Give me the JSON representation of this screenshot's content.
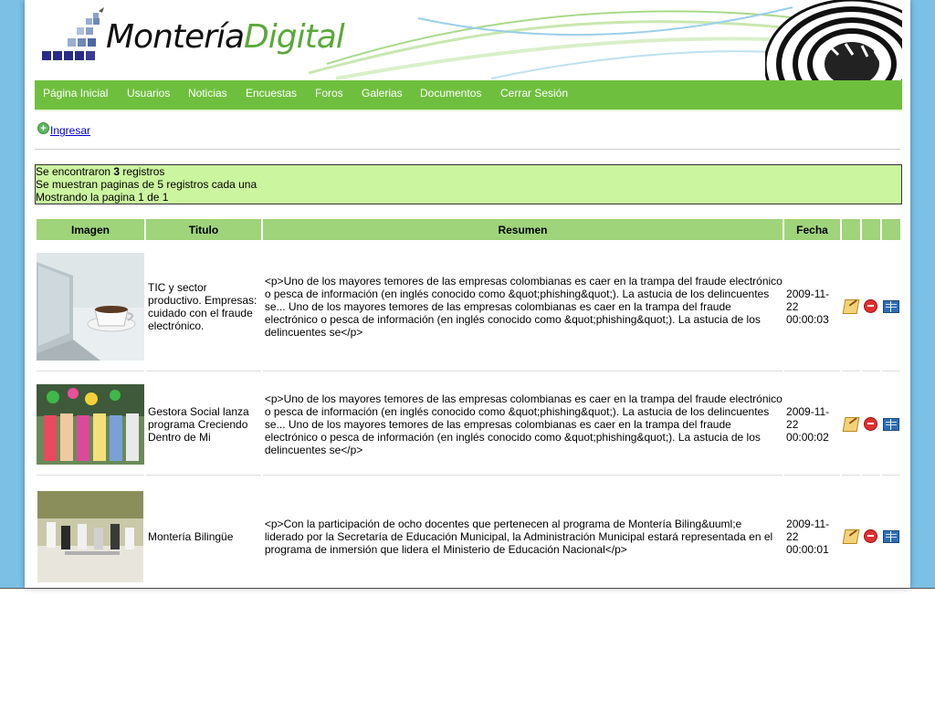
{
  "brand": {
    "part1": "Montería",
    "part2": "Digital"
  },
  "nav": {
    "items": [
      {
        "label": "Página Inicial"
      },
      {
        "label": "Usuarios"
      },
      {
        "label": "Noticias"
      },
      {
        "label": "Encuestas"
      },
      {
        "label": "Foros"
      },
      {
        "label": "Galerias"
      },
      {
        "label": "Documentos"
      },
      {
        "label": "Cerrar Sesión"
      }
    ]
  },
  "toolbar": {
    "add_label": "Ingresar",
    "add_icon": "add-icon"
  },
  "info": {
    "line1_prefix": "Se encontraron ",
    "count": "3",
    "line1_suffix": " registros",
    "line2": "Se muestran paginas de 5 registros cada una",
    "line3": "Mostrando la pagina 1 de 1"
  },
  "table": {
    "headers": {
      "image": "Imagen",
      "title": "Titulo",
      "summary": "Resumen",
      "date": "Fecha"
    },
    "rows": [
      {
        "title": "TIC y sector productivo. Empresas: cuidado con el fraude electrónico.",
        "summary": "<p>Uno de los mayores temores de las empresas colombianas es caer en la trampa del fraude electrónico o pesca de información (en inglés conocido como &quot;phishing&quot;). La astucia de los delincuentes se... Uno de los mayores temores de las empresas colombianas es caer en la trampa del fraude electrónico o pesca de información (en inglés conocido como &quot;phishing&quot;). La astucia de los delincuentes se</p>",
        "date": "2009-11-22 00:00:03"
      },
      {
        "title": "Gestora Social lanza programa Creciendo Dentro de Mi",
        "summary": "<p>Uno de los mayores temores de las empresas colombianas es caer en la trampa del fraude electrónico o pesca de información (en inglés conocido como &quot;phishing&quot;). La astucia de los delincuentes se... Uno de los mayores temores de las empresas colombianas es caer en la trampa del fraude electrónico o pesca de información (en inglés conocido como &quot;phishing&quot;). La astucia de los delincuentes se</p>",
        "date": "2009-11-22 00:00:02"
      },
      {
        "title": "Montería Bilingüe",
        "summary": "<p>Con la participación de ocho docentes que pertenecen al programa de Montería Biling&uuml;e liderado por la Secretaría de Educación Municipal, la Administración Municipal estará representada en el programa de inmersión que lidera el Ministerio de Educación Nacional</p>",
        "date": "2009-11-22 00:00:01"
      }
    ],
    "action_icons": [
      "edit-icon",
      "delete-icon",
      "view-icon"
    ]
  },
  "colors": {
    "nav_bg": "#6fbf3e",
    "header_cell_bg": "#9fd47a",
    "info_bg": "#ccf5a0",
    "outer_bg": "#7cc0e6"
  }
}
